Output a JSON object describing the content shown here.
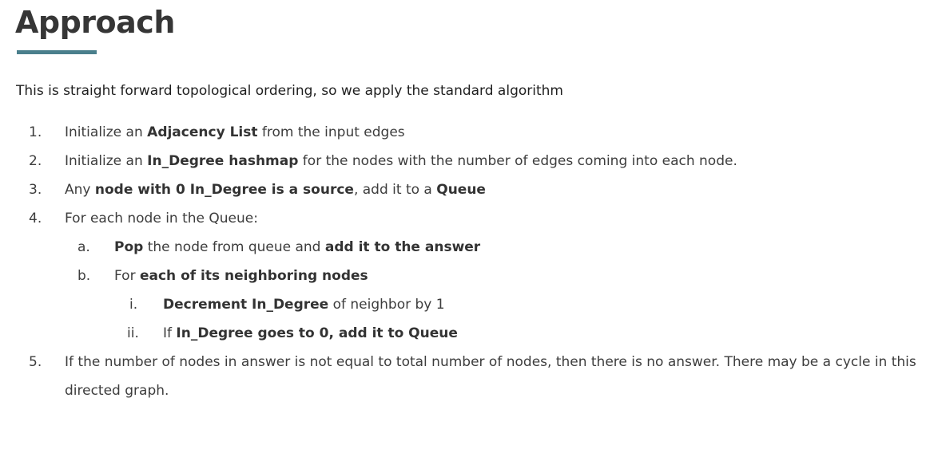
{
  "title": "Approach",
  "intro": "This is straight forward topological ordering, so we apply the standard algorithm",
  "steps": {
    "s1": {
      "marker": "1.",
      "t1": "Initialize an ",
      "b1": "Adjacency List",
      "t2": " from the input edges"
    },
    "s2": {
      "marker": "2.",
      "t1": "Initialize an ",
      "b1": "In_Degree hashmap",
      "t2": " for the nodes with the number of edges coming into each node."
    },
    "s3": {
      "marker": "3.",
      "t1": "Any ",
      "b1": "node with 0 In_Degree is a source",
      "t2": ", add it to a ",
      "b2": "Queue"
    },
    "s4": {
      "marker": "4.",
      "t1": "For each node in the Queue:"
    },
    "s4a": {
      "marker": "a.",
      "b1": "Pop",
      "t1": " the node from queue and ",
      "b2": "add it to the answer"
    },
    "s4b": {
      "marker": "b.",
      "t1": "For ",
      "b1": "each of its neighboring nodes"
    },
    "s4bi": {
      "marker": "i.",
      "b1": "Decrement In_Degree",
      "t1": " of neighbor by 1"
    },
    "s4bii": {
      "marker": "ii.",
      "t1": "If ",
      "b1": "In_Degree goes to 0, add it to Queue"
    },
    "s5": {
      "marker": "5.",
      "t1": "If the number of nodes in answer is not equal to total number of nodes, then there is no answer. There may be a cycle in this directed graph."
    }
  }
}
